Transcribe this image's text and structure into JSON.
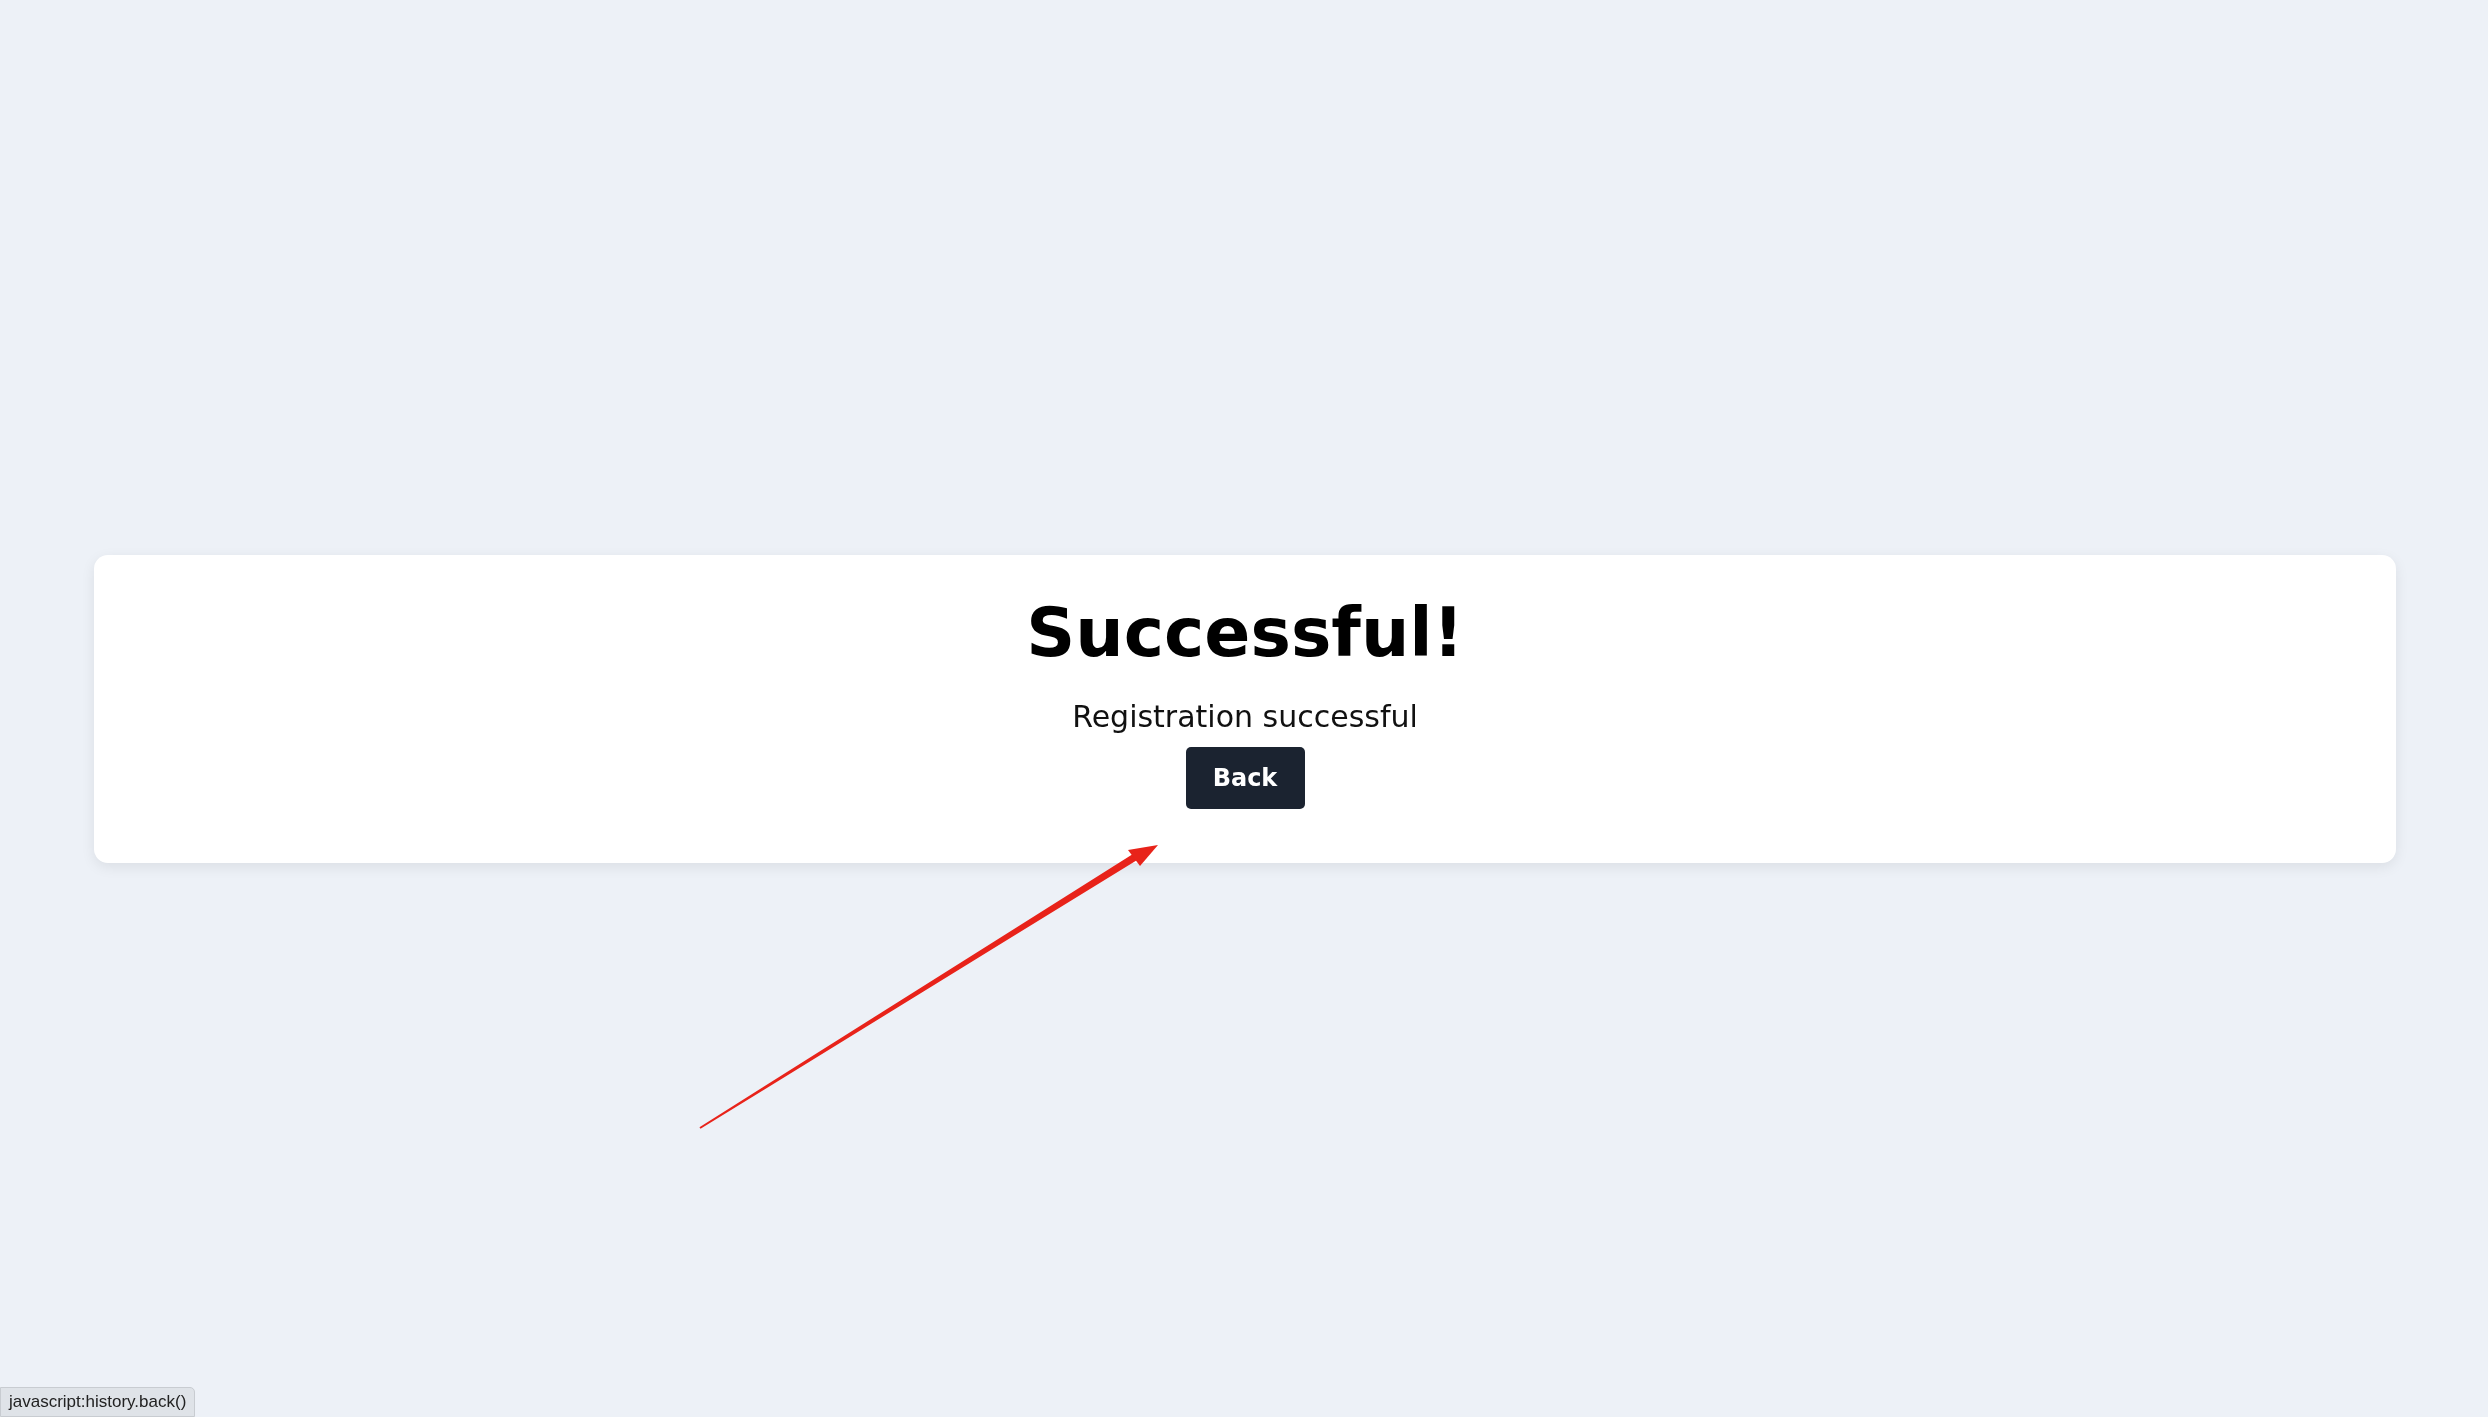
{
  "card": {
    "title": "Successful!",
    "message": "Registration successful",
    "button": "Back"
  },
  "status_bar": {
    "url": "javascript:history.back()"
  }
}
